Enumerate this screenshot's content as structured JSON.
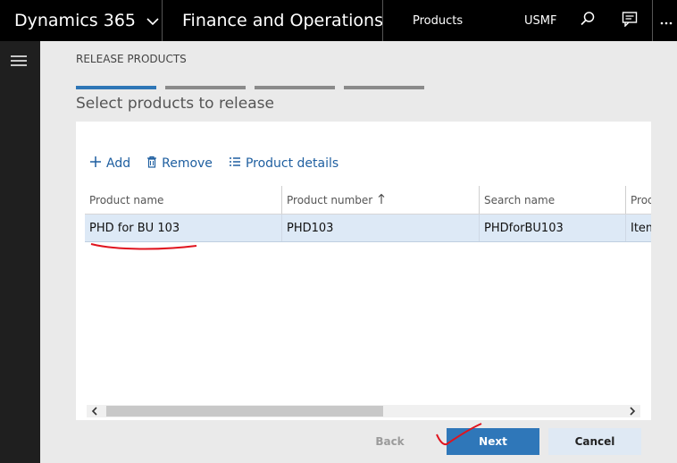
{
  "topbar": {
    "brand": "Dynamics 365",
    "app_title": "Finance and Operations",
    "module": "Products",
    "company": "USMF",
    "icons": [
      "chevron-down-icon",
      "search-icon",
      "chat-icon",
      "more-icon"
    ]
  },
  "leftnav": {
    "icon": "hamburger-icon"
  },
  "wizard": {
    "breadcrumb": "RELEASE PRODUCTS",
    "steps_total": 4,
    "active_step": 1,
    "title": "Select products to release"
  },
  "toolbar": {
    "add_label": "Add",
    "remove_label": "Remove",
    "details_label": "Product details"
  },
  "grid": {
    "columns": [
      "Product name",
      "Product number",
      "Search name",
      "Product type"
    ],
    "sorted_column": "Product number",
    "sort_direction": "ascending",
    "rows": [
      {
        "product_name": "PHD for BU 103",
        "product_number": "PHD103",
        "search_name": "PHDforBU103",
        "product_type": "Item"
      }
    ]
  },
  "footer": {
    "back_label": "Back",
    "next_label": "Next",
    "cancel_label": "Cancel"
  },
  "colors": {
    "topbar_bg": "#000000",
    "accent": "#2f77b9",
    "link": "#1f5fa0",
    "row_selected": "#dde9f6",
    "annotation": "#e0141e"
  }
}
